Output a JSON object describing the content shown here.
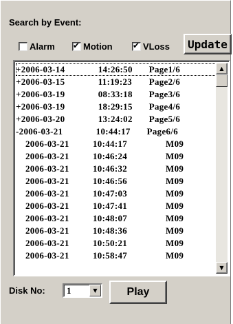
{
  "search": {
    "heading": "Search by Event:",
    "filters": [
      {
        "label": "Alarm",
        "checked": false
      },
      {
        "label": "Motion",
        "checked": true
      },
      {
        "label": "VLoss",
        "checked": true
      }
    ],
    "update_label": "Update"
  },
  "events": {
    "summary_rows": [
      {
        "prefix": "+",
        "date": "2006-03-14",
        "time": "14:26:50",
        "page": "Page1/6",
        "selected": true
      },
      {
        "prefix": "+",
        "date": "2006-03-15",
        "time": "11:19:23",
        "page": "Page2/6"
      },
      {
        "prefix": "+",
        "date": "2006-03-19",
        "time": "08:33:18",
        "page": "Page3/6"
      },
      {
        "prefix": "+",
        "date": "2006-03-19",
        "time": "18:29:15",
        "page": "Page4/6"
      },
      {
        "prefix": "+",
        "date": "2006-03-20",
        "time": "13:24:02",
        "page": "Page5/6"
      },
      {
        "prefix": "-",
        "date": "2006-03-21",
        "time": "10:44:17",
        "page": "Page6/6"
      }
    ],
    "detail_rows": [
      {
        "date": "2006-03-21",
        "time": "10:44:17",
        "code": "M09"
      },
      {
        "date": "2006-03-21",
        "time": "10:46:24",
        "code": "M09"
      },
      {
        "date": "2006-03-21",
        "time": "10:46:32",
        "code": "M09"
      },
      {
        "date": "2006-03-21",
        "time": "10:46:56",
        "code": "M09"
      },
      {
        "date": "2006-03-21",
        "time": "10:47:03",
        "code": "M09"
      },
      {
        "date": "2006-03-21",
        "time": "10:47:41",
        "code": "M09"
      },
      {
        "date": "2006-03-21",
        "time": "10:48:07",
        "code": "M09"
      },
      {
        "date": "2006-03-21",
        "time": "10:48:36",
        "code": "M09"
      },
      {
        "date": "2006-03-21",
        "time": "10:50:21",
        "code": "M09"
      },
      {
        "date": "2006-03-21",
        "time": "10:58:47",
        "code": "M09"
      }
    ]
  },
  "footer": {
    "disk_label": "Disk No:",
    "disk_value": "1",
    "play_label": "Play"
  },
  "icons": {
    "checkbox_check": "checkmark-icon",
    "scroll_up": "arrow-up-icon",
    "scroll_down": "arrow-down-icon",
    "dropdown": "chevron-down-icon"
  }
}
